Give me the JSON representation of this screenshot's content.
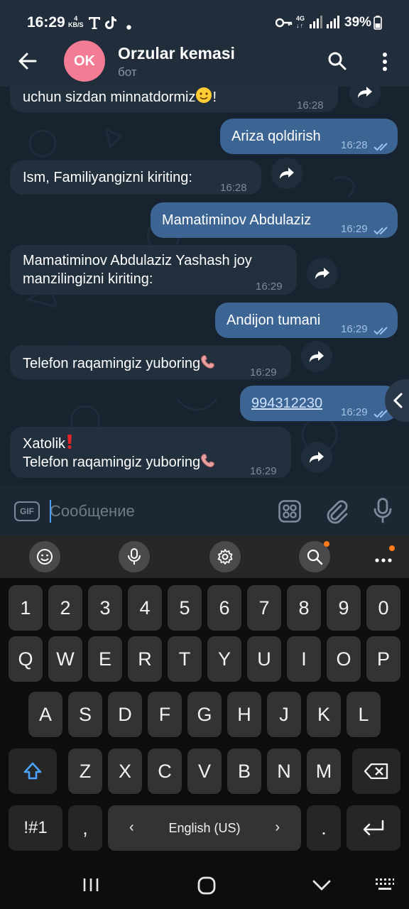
{
  "status_bar": {
    "time": "16:29",
    "net_speed_top": "4",
    "net_speed_bottom": "KB/S",
    "network_type": "4G",
    "battery": "39%",
    "icons": [
      "tmobile-icon",
      "tiktok-icon",
      "dot-icon",
      "key-icon",
      "signal-icon",
      "battery-icon"
    ]
  },
  "header": {
    "back_icon": "arrow-left-icon",
    "avatar_initials": "OK",
    "avatar_color": "#f37b94",
    "title": "Orzular kemasi",
    "subtitle": "бот",
    "search_icon": "search-icon",
    "menu_icon": "more-vertical-icon"
  },
  "messages": [
    {
      "direction": "in",
      "text": "uchun sizdan minnatdormiz",
      "emoji": "slightly-smiling-face",
      "suffix": "!",
      "time": "16:28"
    },
    {
      "direction": "out",
      "text": "Ariza qoldirish",
      "time": "16:28",
      "read": true
    },
    {
      "direction": "in",
      "text": "Ism, Familiyangizni kiriting:",
      "time": "16:28"
    },
    {
      "direction": "out",
      "text": "Mamatiminov Abdulaziz",
      "time": "16:29",
      "read": true
    },
    {
      "direction": "in",
      "line1": "Mamatiminov Abdulaziz Yashash joy",
      "line2": "manzilingizni kiriting:",
      "time": "16:29"
    },
    {
      "direction": "out",
      "text": "Andijon tumani",
      "time": "16:29",
      "read": true
    },
    {
      "direction": "in",
      "text": "Telefon raqamingiz yuboring",
      "emoji": "telephone-receiver",
      "time": "16:29"
    },
    {
      "direction": "out",
      "text": "994312230",
      "time": "16:29",
      "read": true,
      "is_link": true
    },
    {
      "direction": "in",
      "line1": "Xatolik",
      "line1_emoji": "red-exclamation-mark",
      "line2": "Telefon raqamingiz yuboring",
      "line2_emoji": "telephone-receiver",
      "time": "16:29"
    }
  ],
  "input_bar": {
    "gif_label": "GIF",
    "placeholder": "Сообщение",
    "value": "",
    "icons": [
      "sticker-grid-icon",
      "paperclip-icon",
      "microphone-icon"
    ]
  },
  "keyboard": {
    "toolbar_icons": [
      "emoji-icon",
      "voice-input-icon",
      "settings-icon",
      "search-icon",
      "more-icon"
    ],
    "row_numbers": [
      "1",
      "2",
      "3",
      "4",
      "5",
      "6",
      "7",
      "8",
      "9",
      "0"
    ],
    "row_1": [
      "Q",
      "W",
      "E",
      "R",
      "T",
      "Y",
      "U",
      "I",
      "O",
      "P"
    ],
    "row_2": [
      "A",
      "S",
      "D",
      "F",
      "G",
      "H",
      "J",
      "K",
      "L"
    ],
    "row_3": [
      "Z",
      "X",
      "C",
      "V",
      "B",
      "N",
      "M"
    ],
    "symbols_key": "!#1",
    "comma_key": ",",
    "space_label": "English (US)",
    "period_key": ".",
    "accent_color": "#4aa3ff"
  },
  "nav_bar": {
    "icons": [
      "recents-icon",
      "home-icon",
      "back-chevron-icon",
      "keyboard-toggle-icon"
    ]
  }
}
